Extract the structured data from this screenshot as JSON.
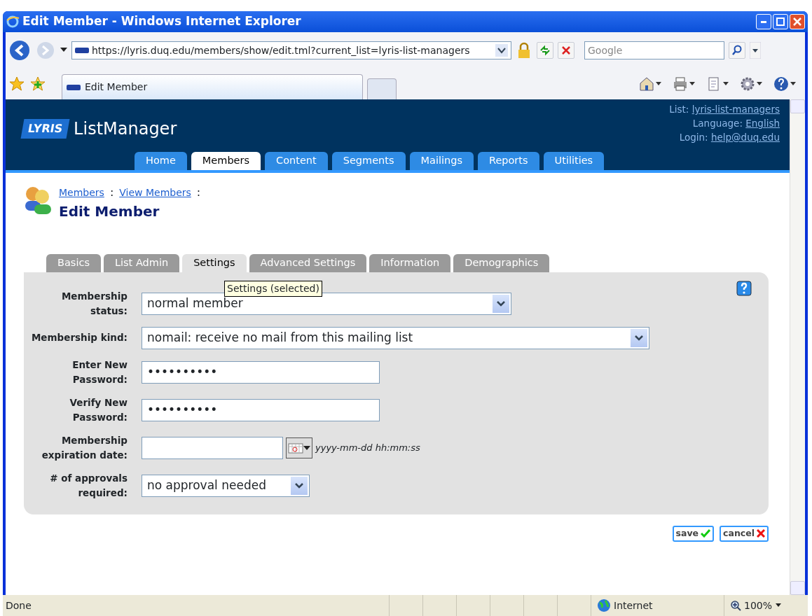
{
  "window": {
    "title": "Edit Member - Windows Internet Explorer"
  },
  "browser": {
    "address": "https://lyris.duq.edu/members/show/edit.tml?current_list=lyris-list-managers",
    "search_placeholder": "Google",
    "tab": "Edit Member"
  },
  "app": {
    "logo": "LYRIS",
    "product": "ListManager",
    "info": [
      {
        "label": "List:",
        "value": "lyris-list-managers"
      },
      {
        "label": "Language:",
        "value": "English"
      },
      {
        "label": "Login:",
        "value": "help@duq.edu"
      }
    ],
    "nav": [
      {
        "label": "Home",
        "selected": false
      },
      {
        "label": "Members",
        "selected": true
      },
      {
        "label": "Content",
        "selected": false
      },
      {
        "label": "Segments",
        "selected": false
      },
      {
        "label": "Mailings",
        "selected": false
      },
      {
        "label": "Reports",
        "selected": false
      },
      {
        "label": "Utilities",
        "selected": false
      }
    ]
  },
  "breadcrumbs": [
    {
      "label": "Members",
      "separator": ":"
    },
    {
      "label": "View Members",
      "separator": ":"
    }
  ],
  "heading": "Edit Member",
  "subtabs": [
    {
      "label": "Basics",
      "selected": false
    },
    {
      "label": "List Admin",
      "selected": false
    },
    {
      "label": "Settings",
      "selected": true
    },
    {
      "label": "Advanced Settings",
      "selected": false
    },
    {
      "label": "Information",
      "selected": false
    },
    {
      "label": "Demographics",
      "selected": false
    }
  ],
  "tooltip": "Settings (selected)",
  "fields": [
    {
      "kind": "select",
      "label": "Membership status:",
      "value": "normal member"
    },
    {
      "kind": "select",
      "label": "Membership kind:",
      "value": "nomail: receive no mail from this mailing list"
    },
    {
      "kind": "password",
      "label": "Enter New Password:",
      "value": "••••••••••"
    },
    {
      "kind": "password",
      "label": "Verify New Password:",
      "value": "••••••••••"
    },
    {
      "kind": "date",
      "label": "Membership expiration date:",
      "hint": "yyyy-mm-dd hh:mm:ss"
    },
    {
      "kind": "select",
      "label": "# of approvals required:",
      "value": "no approval needed"
    }
  ],
  "buttons": [
    {
      "kind": "save",
      "label": "save"
    },
    {
      "kind": "cancel",
      "label": "cancel"
    }
  ],
  "status_bar": {
    "text": "Done",
    "zone": "Internet",
    "zoom": "100%"
  }
}
